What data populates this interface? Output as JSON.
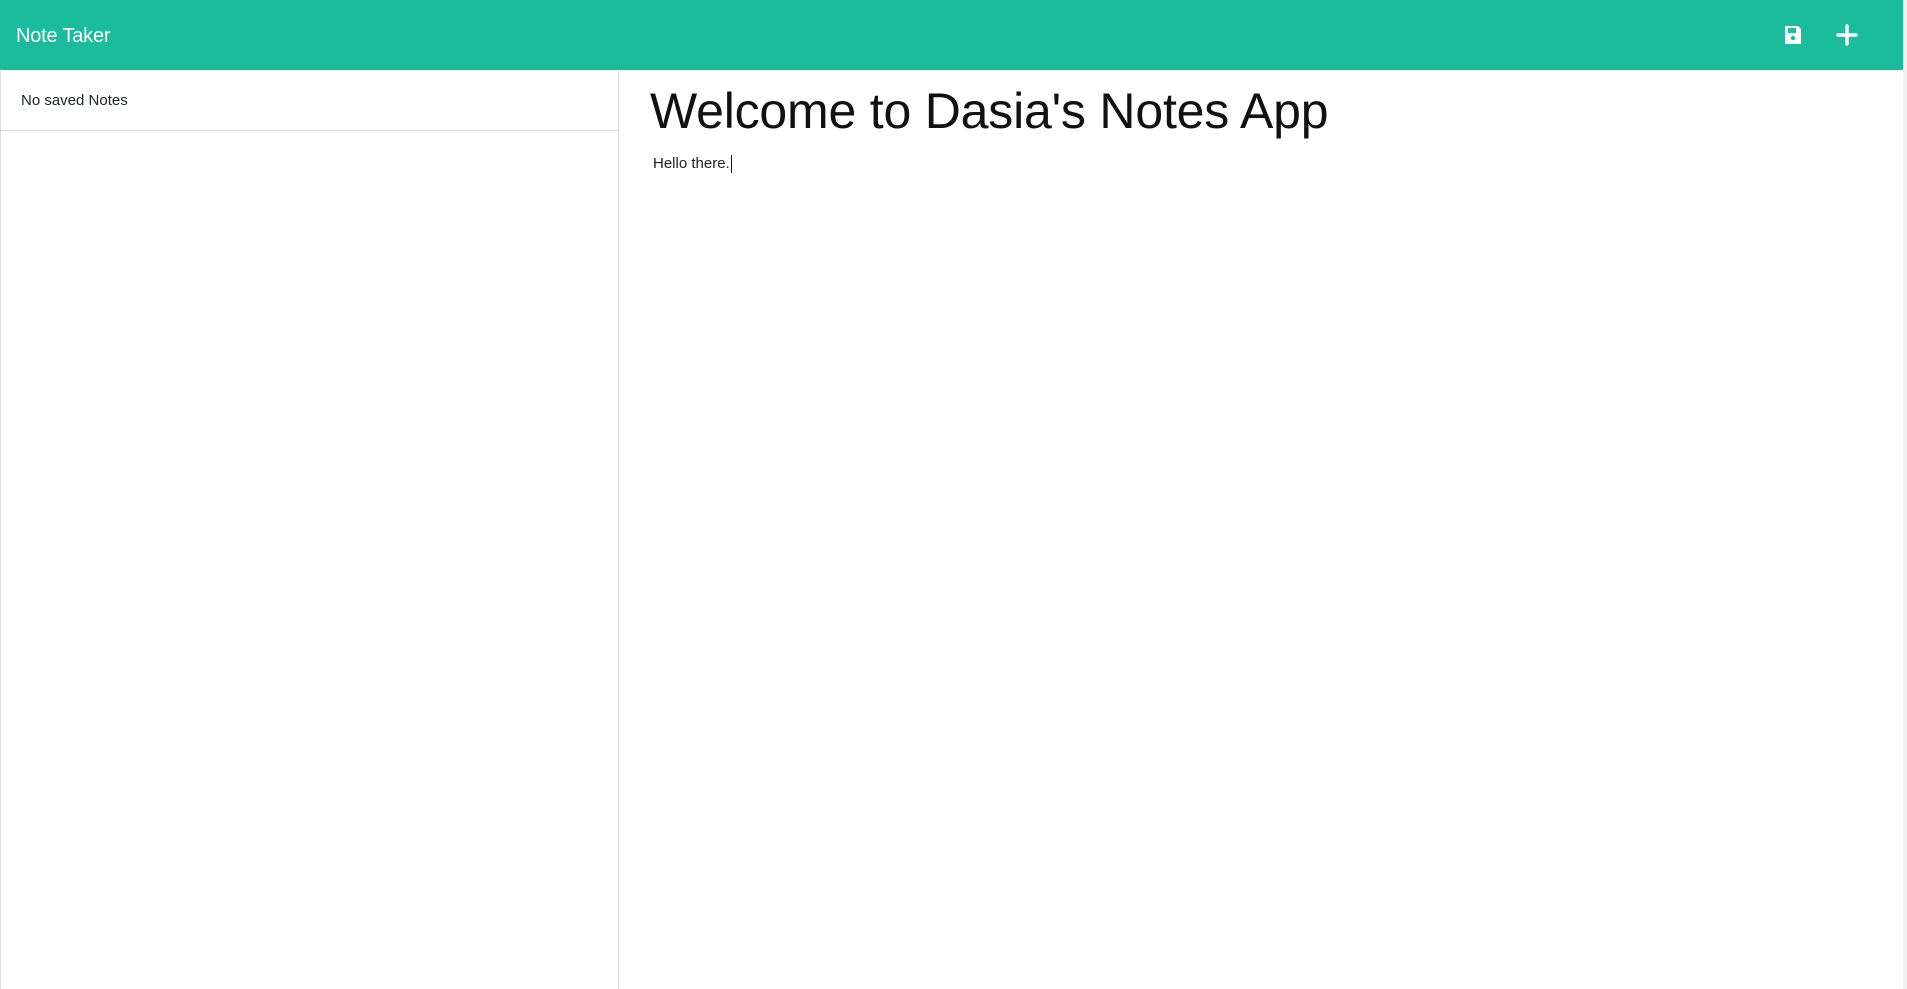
{
  "header": {
    "brand": "Note Taker",
    "actions": [
      {
        "icon": "save-icon"
      },
      {
        "icon": "plus-icon"
      }
    ]
  },
  "sidebar": {
    "empty_label": "No saved Notes"
  },
  "note": {
    "title": "Welcome to Dasia's Notes App",
    "body": "Hello there."
  },
  "colors": {
    "brand": "#1abc9c",
    "background": "#ffffff",
    "border": "#dcdcdc"
  }
}
